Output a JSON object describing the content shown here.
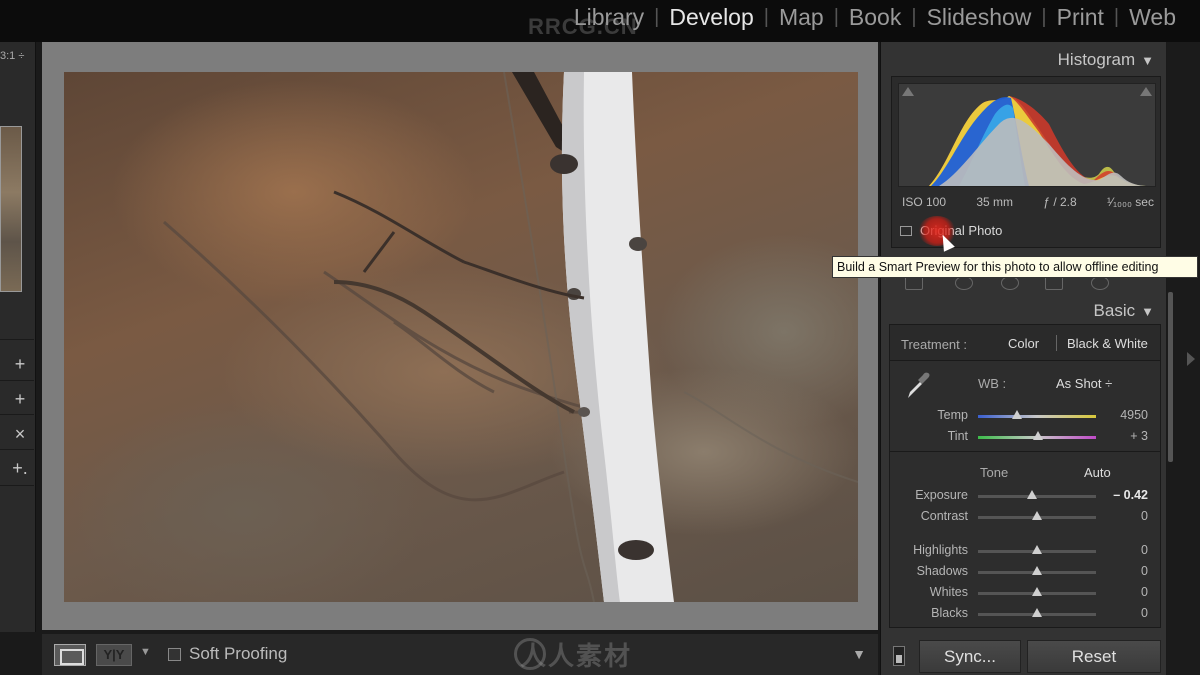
{
  "modules": [
    "Library",
    "Develop",
    "Map",
    "Book",
    "Slideshow",
    "Print",
    "Web"
  ],
  "active_module": "Develop",
  "watermark_top": "RRCG.CN",
  "watermark_bottom": "人人素材",
  "left": {
    "zoom": "3:1 ÷",
    "buttons": [
      "+",
      "+",
      "×",
      "+."
    ]
  },
  "toolbar": {
    "yy_label": "Y|Y",
    "soft_proofing": "Soft Proofing",
    "menu_icon": "triangle-down"
  },
  "histogram": {
    "title": "Histogram",
    "iso": "ISO 100",
    "focal": "35 mm",
    "aperture": "ƒ / 2.8",
    "shutter": "¹⁄₁₀₀₀ sec",
    "original_photo": "Original Photo"
  },
  "tooltip": "Build a Smart Preview for this photo to allow offline editing",
  "basic": {
    "title": "Basic",
    "treatment_label": "Treatment :",
    "treatment_color": "Color",
    "treatment_bw": "Black & White",
    "wb_label": "WB :",
    "wb_value": "As Shot ÷",
    "tone_label": "Tone",
    "auto_label": "Auto"
  },
  "sliders": [
    {
      "name": "Temp",
      "value": "4950",
      "pos": 0.33,
      "grad": "temp"
    },
    {
      "name": "Tint",
      "value": "+ 3",
      "pos": 0.51,
      "grad": "tint"
    },
    {
      "name": "Exposure",
      "value": "– 0.42",
      "pos": 0.46,
      "bold": true
    },
    {
      "name": "Contrast",
      "value": "0",
      "pos": 0.5
    },
    {
      "name": "Highlights",
      "value": "0",
      "pos": 0.5
    },
    {
      "name": "Shadows",
      "value": "0",
      "pos": 0.5
    },
    {
      "name": "Whites",
      "value": "0",
      "pos": 0.5
    },
    {
      "name": "Blacks",
      "value": "0",
      "pos": 0.5
    }
  ],
  "buttons": {
    "sync": "Sync...",
    "reset": "Reset"
  }
}
